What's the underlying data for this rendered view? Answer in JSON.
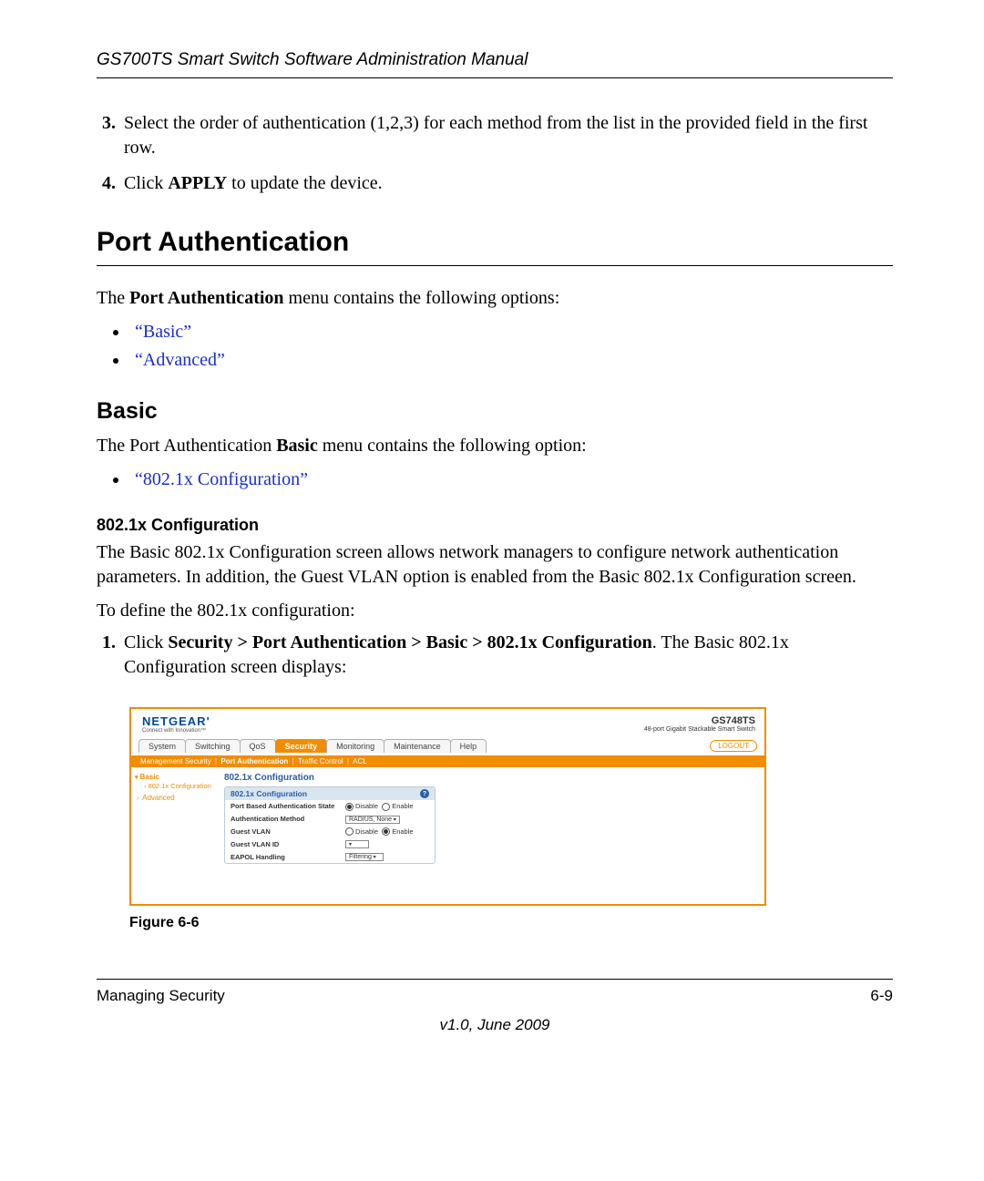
{
  "header": {
    "title": "GS700TS Smart Switch Software Administration Manual"
  },
  "steps_top": [
    "Select the order of authentication (1,2,3) for each method from the list in the provided field in the first row.",
    "Click APPLY to update the device."
  ],
  "section": {
    "title": "Port Authentication"
  },
  "intro": {
    "prefix": "The ",
    "bold": "Port Authentication",
    "suffix": " menu contains the following options:"
  },
  "links_main": [
    "“Basic”",
    "“Advanced”"
  ],
  "sub": {
    "title": "Basic"
  },
  "sub_intro": {
    "prefix": "The Port Authentication ",
    "bold": "Basic",
    "suffix": " menu contains the following option:"
  },
  "links_sub": [
    "“802.1x Configuration”"
  ],
  "subsub": {
    "title": "802.1x Configuration"
  },
  "desc": "The Basic 802.1x Configuration screen allows network managers to configure network authentication parameters. In addition, the Guest VLAN option is enabled from the Basic 802.1x Configuration screen.",
  "lead": "To define the 802.1x configuration:",
  "step1": {
    "prefix": "Click ",
    "path": "Security > Port Authentication > Basic > 802.1x Configuration",
    "suffix": ". The Basic 802.1x Configuration screen displays:"
  },
  "figure": {
    "logo": "NETGEAR",
    "tagline": "Connect with Innovation™",
    "model": "GS748TS",
    "model_desc": "48-port Gigabit Stackable Smart Switch",
    "tabs": [
      "System",
      "Switching",
      "QoS",
      "Security",
      "Monitoring",
      "Maintenance",
      "Help"
    ],
    "active_tab": "Security",
    "logout": "LOGOUT",
    "subtabs": [
      "Management Security",
      "Port Authentication",
      "Traffic Control",
      "ACL"
    ],
    "active_subtab": "Port Authentication",
    "sidebar": {
      "basic": "Basic",
      "basic_sub": "802.1x Configuration",
      "advanced": "Advanced"
    },
    "panel_title": "802.1x Configuration",
    "box_title": "802.1x Configuration",
    "rows": {
      "r1": {
        "label": "Port Based Authentication State",
        "opt1": "Disable",
        "opt2": "Enable"
      },
      "r2": {
        "label": "Authentication Method",
        "value": "RADIUS, None"
      },
      "r3": {
        "label": "Guest VLAN",
        "opt1": "Disable",
        "opt2": "Enable"
      },
      "r4": {
        "label": "Guest VLAN ID",
        "value": ""
      },
      "r5": {
        "label": "EAPOL Handling",
        "value": "Filtering"
      }
    },
    "caption": "Figure 6-6"
  },
  "footer": {
    "left": "Managing Security",
    "right": "6-9",
    "version": "v1.0, June 2009"
  }
}
